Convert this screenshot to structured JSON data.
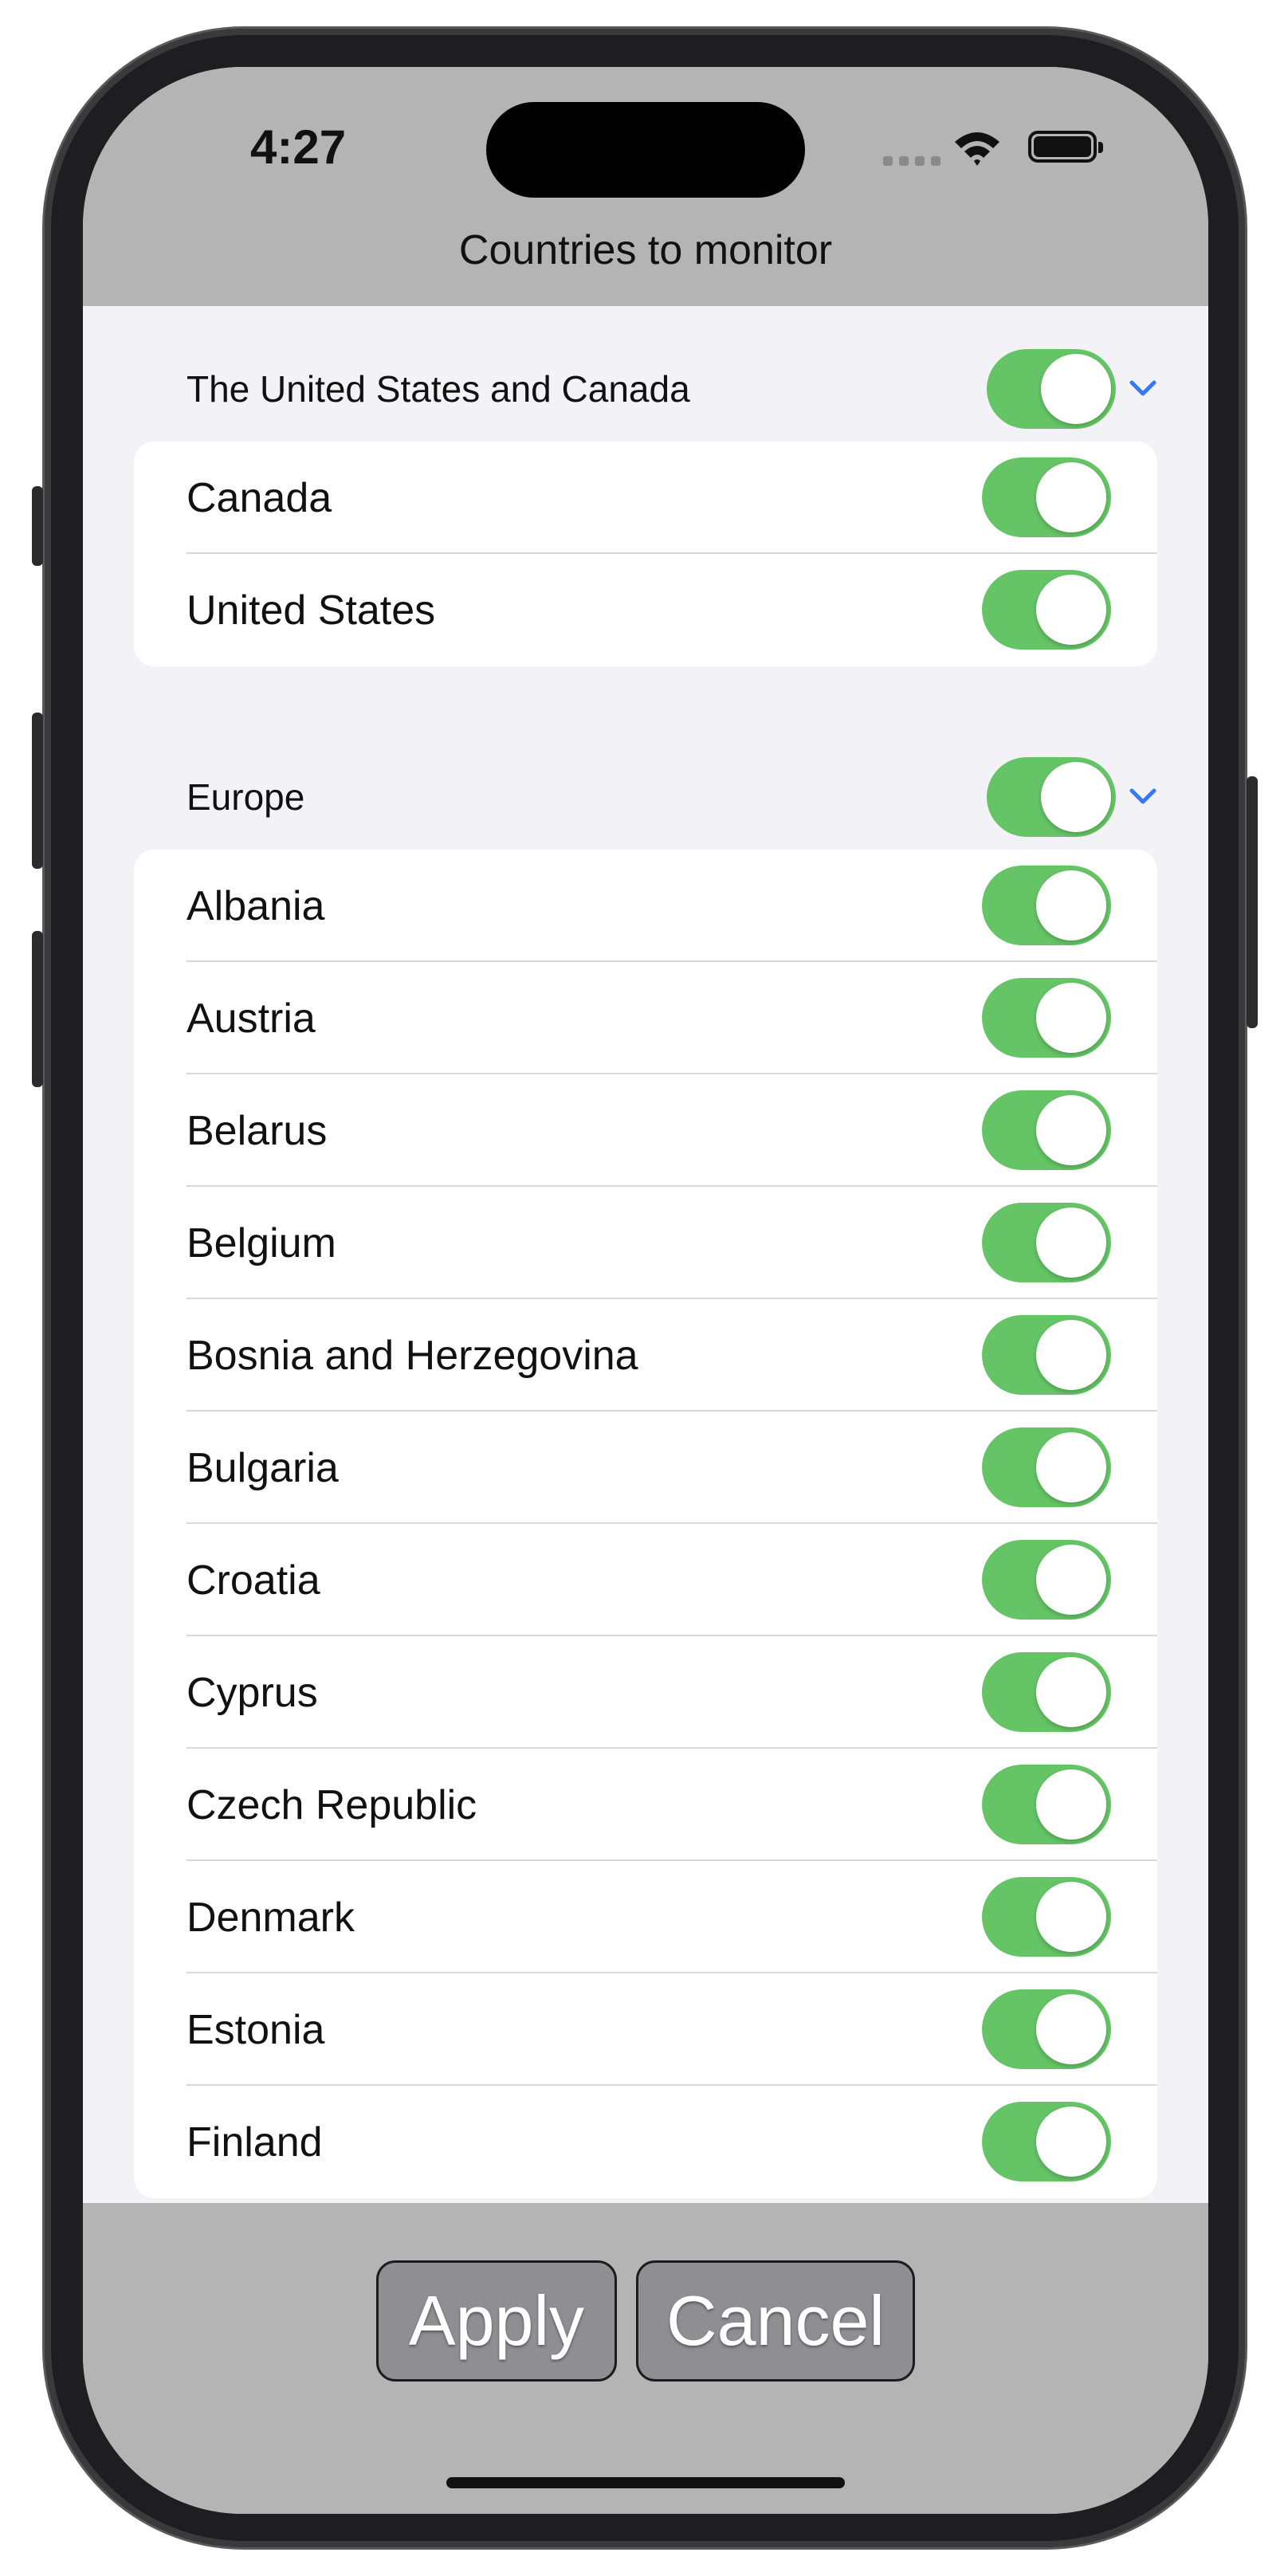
{
  "status_bar": {
    "time": "4:27"
  },
  "nav": {
    "title": "Countries to monitor"
  },
  "sections": [
    {
      "title": "The United States and Canada",
      "enabled": true,
      "countries": [
        {
          "name": "Canada",
          "enabled": true
        },
        {
          "name": "United States",
          "enabled": true
        }
      ]
    },
    {
      "title": "Europe",
      "enabled": true,
      "countries": [
        {
          "name": "Albania",
          "enabled": true
        },
        {
          "name": "Austria",
          "enabled": true
        },
        {
          "name": "Belarus",
          "enabled": true
        },
        {
          "name": "Belgium",
          "enabled": true
        },
        {
          "name": "Bosnia and Herzegovina",
          "enabled": true
        },
        {
          "name": "Bulgaria",
          "enabled": true
        },
        {
          "name": "Croatia",
          "enabled": true
        },
        {
          "name": "Cyprus",
          "enabled": true
        },
        {
          "name": "Czech Republic",
          "enabled": true
        },
        {
          "name": "Denmark",
          "enabled": true
        },
        {
          "name": "Estonia",
          "enabled": true
        },
        {
          "name": "Finland",
          "enabled": true
        }
      ]
    }
  ],
  "actions": {
    "apply_label": "Apply",
    "cancel_label": "Cancel"
  },
  "colors": {
    "toggle_on": "#65c466",
    "chevron": "#3478f6",
    "bar_background": "#b4b4b4"
  }
}
